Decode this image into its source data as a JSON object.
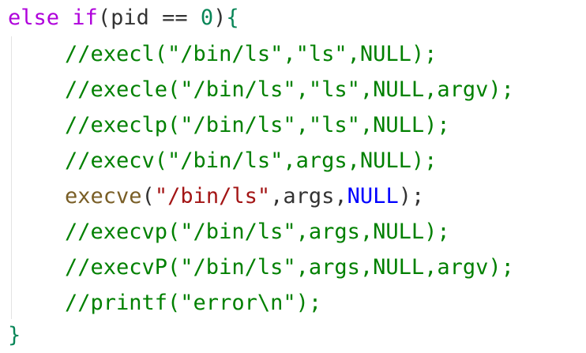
{
  "colors": {
    "keyword": "#af00db",
    "comment": "#008000",
    "function": "#795e26",
    "string": "#a31515",
    "number": "#098658",
    "constant": "#0000ff",
    "plain": "#333333"
  },
  "code": {
    "line1": {
      "else_kw": "else",
      "sp1": " ",
      "if_kw": "if",
      "cond_open": "(pid == ",
      "zero": "0",
      "cond_close": ")",
      "open_brace": "{"
    },
    "comments": [
      "//execl(\"/bin/ls\",\"ls\",NULL);",
      "//execle(\"/bin/ls\",\"ls\",NULL,argv);",
      "//execlp(\"/bin/ls\",\"ls\",NULL);",
      "//execv(\"/bin/ls\",args,NULL);",
      "//execvp(\"/bin/ls\",args,NULL);",
      "//execvP(\"/bin/ls\",args,NULL,argv);",
      "//printf(\"error\\n\");"
    ],
    "execve_line": {
      "func": "execve",
      "open_paren": "(",
      "path_string": "\"/bin/ls\"",
      "args_part": ",args,",
      "null_const": "NULL",
      "close": ");"
    },
    "close_brace": "}"
  }
}
